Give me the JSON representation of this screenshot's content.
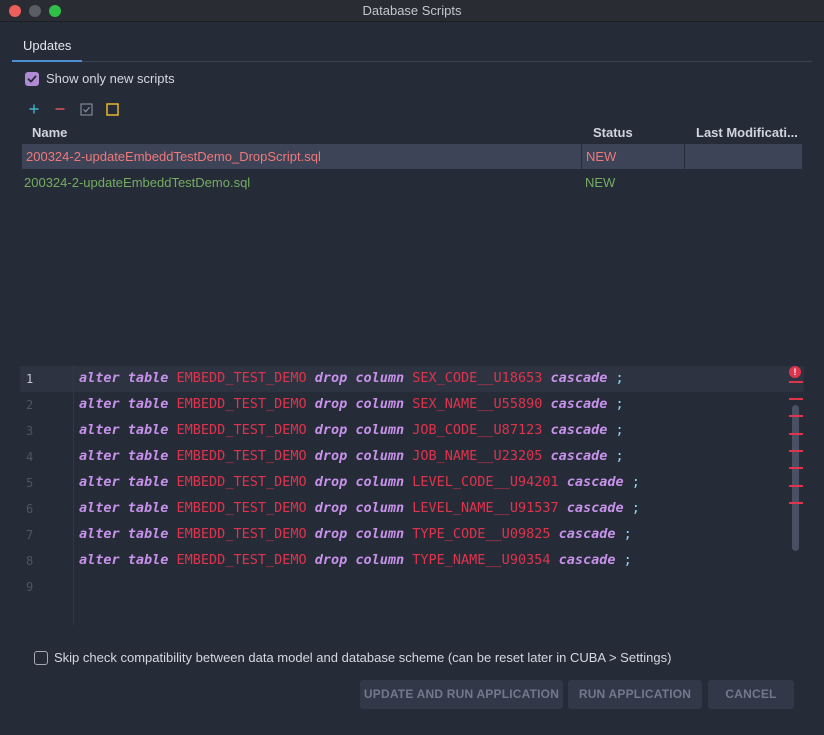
{
  "window": {
    "title": "Database Scripts"
  },
  "tabs": [
    {
      "label": "Updates"
    }
  ],
  "filter": {
    "show_only_new_label": "Show only new scripts",
    "checked": true
  },
  "toolbar": {
    "icons": [
      "add-icon",
      "remove-icon",
      "select-all-icon",
      "mark-applied-icon"
    ]
  },
  "grid": {
    "columns": [
      "Name",
      "Status",
      "Last Modificati..."
    ],
    "rows": [
      {
        "name": "200324-2-updateEmbeddTestDemo_DropScript.sql",
        "status": "NEW",
        "last_modified": "",
        "color": "#f07878"
      },
      {
        "name": "200324-2-updateEmbeddTestDemo.sql",
        "status": "NEW",
        "last_modified": "",
        "color": "#74ac62"
      }
    ]
  },
  "editor": {
    "line_numbers": [
      "1",
      "2",
      "3",
      "4",
      "5",
      "6",
      "7",
      "8",
      "9"
    ],
    "lines": [
      {
        "kw1": "alter table",
        "table": "EMBEDD_TEST_DEMO",
        "kw2": "drop column",
        "column": "SEX_CODE__U18653",
        "kw3": "cascade",
        "end": ";"
      },
      {
        "kw1": "alter table",
        "table": "EMBEDD_TEST_DEMO",
        "kw2": "drop column",
        "column": "SEX_NAME__U55890",
        "kw3": "cascade",
        "end": ";"
      },
      {
        "kw1": "alter table",
        "table": "EMBEDD_TEST_DEMO",
        "kw2": "drop column",
        "column": "JOB_CODE__U87123",
        "kw3": "cascade",
        "end": ";"
      },
      {
        "kw1": "alter table",
        "table": "EMBEDD_TEST_DEMO",
        "kw2": "drop column",
        "column": "JOB_NAME__U23205",
        "kw3": "cascade",
        "end": ";"
      },
      {
        "kw1": "alter table",
        "table": "EMBEDD_TEST_DEMO",
        "kw2": "drop column",
        "column": "LEVEL_CODE__U94201",
        "kw3": "cascade",
        "end": ";"
      },
      {
        "kw1": "alter table",
        "table": "EMBEDD_TEST_DEMO",
        "kw2": "drop column",
        "column": "LEVEL_NAME__U91537",
        "kw3": "cascade",
        "end": ";"
      },
      {
        "kw1": "alter table",
        "table": "EMBEDD_TEST_DEMO",
        "kw2": "drop column",
        "column": "TYPE_CODE__U09825",
        "kw3": "cascade",
        "end": ";"
      },
      {
        "kw1": "alter table",
        "table": "EMBEDD_TEST_DEMO",
        "kw2": "drop column",
        "column": "TYPE_NAME__U90354",
        "kw3": "cascade",
        "end": ";"
      }
    ],
    "error_icon": "!"
  },
  "skip_check": {
    "label": "Skip check compatibility between data model and database scheme (can be reset later in CUBA > Settings)",
    "checked": false
  },
  "buttons": {
    "update_and_run": "UPDATE AND RUN APPLICATION",
    "run": "RUN APPLICATION",
    "cancel": "CANCEL"
  },
  "colors": {
    "accent": "#4e8fd1",
    "checkbox": "#b08ad3",
    "error": "#e0334c",
    "new_script": "#74ac62",
    "drop_script": "#f07878"
  }
}
